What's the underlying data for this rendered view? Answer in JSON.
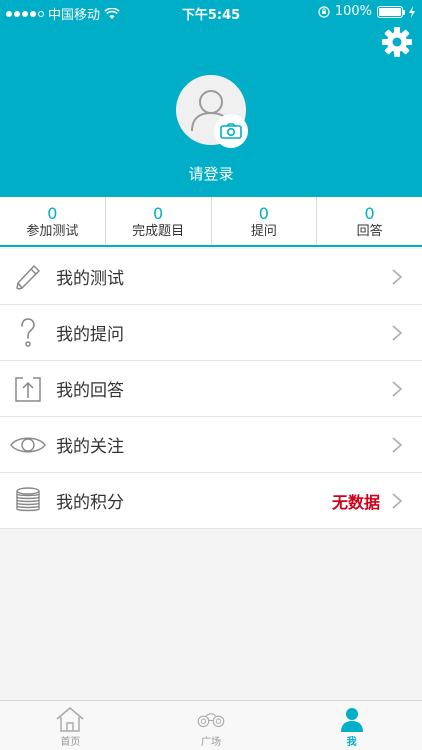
{
  "status_bar": {
    "carrier": "中国移动",
    "time": "下午5:45",
    "battery": "100%"
  },
  "profile": {
    "login_text": "请登录"
  },
  "stats": [
    {
      "value": "0",
      "label": "参加测试"
    },
    {
      "value": "0",
      "label": "完成题目"
    },
    {
      "value": "0",
      "label": "提问"
    },
    {
      "value": "0",
      "label": "回答"
    }
  ],
  "menu": {
    "items": [
      {
        "label": "我的测试",
        "icon": "pencil-icon"
      },
      {
        "label": "我的提问",
        "icon": "question-icon"
      },
      {
        "label": "我的回答",
        "icon": "upload-icon"
      },
      {
        "label": "我的关注",
        "icon": "eye-icon"
      },
      {
        "label": "我的积分",
        "icon": "coins-icon",
        "extra": "无数据"
      }
    ]
  },
  "tabbar": {
    "tabs": [
      {
        "label": "首页",
        "icon": "home-icon"
      },
      {
        "label": "广场",
        "icon": "binoculars-icon"
      },
      {
        "label": "我",
        "icon": "user-icon",
        "active": true
      }
    ]
  },
  "colors": {
    "accent": "#00afc7",
    "extra_text": "#d0021b"
  }
}
